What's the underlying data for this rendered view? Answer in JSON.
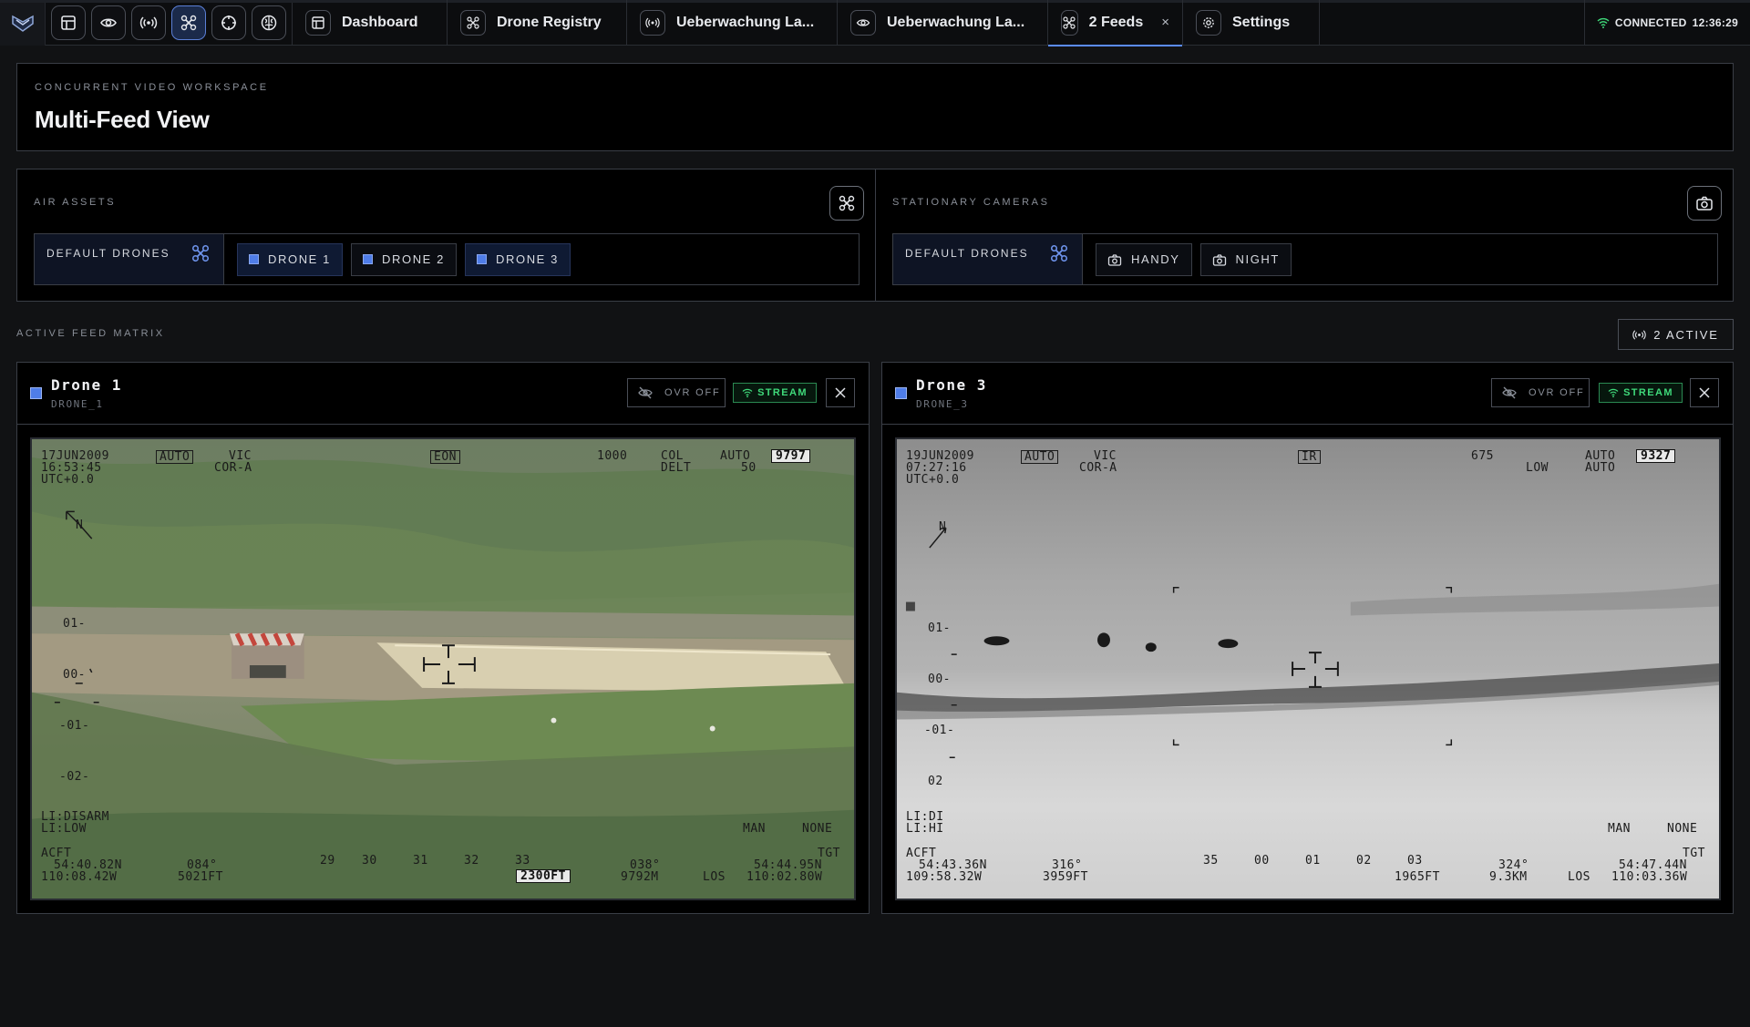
{
  "topbar": {
    "tabs": [
      {
        "label": "Dashboard",
        "icon": "dashboard-icon"
      },
      {
        "label": "Drone Registry",
        "icon": "drone-icon"
      },
      {
        "label": "Ueberwachung La...",
        "icon": "broadcast-icon"
      },
      {
        "label": "Ueberwachung La...",
        "icon": "eye-icon"
      },
      {
        "label": "2 Feeds",
        "icon": "drone-icon",
        "active": true,
        "close": "×"
      },
      {
        "label": "Settings",
        "icon": "gear-icon"
      }
    ],
    "status": "CONNECTED",
    "time": "12:36:29"
  },
  "header": {
    "kicker": "CONCURRENT VIDEO WORKSPACE",
    "title": "Multi-Feed View"
  },
  "assets": {
    "air": {
      "kicker": "AIR ASSETS",
      "default_label": "DEFAULT DRONES",
      "items": [
        "DRONE 1",
        "DRONE 2",
        "DRONE 3"
      ]
    },
    "cameras": {
      "kicker": "STATIONARY CAMERAS",
      "default_label": "DEFAULT DRONES",
      "items": [
        "HANDY",
        "NIGHT"
      ]
    }
  },
  "matrix": {
    "label": "ACTIVE FEED MATRIX",
    "active_count": "2 ACTIVE"
  },
  "feeds": [
    {
      "title": "Drone 1",
      "id": "DRONE_1",
      "overlay": "OVR OFF",
      "stream": "STREAM",
      "osd": {
        "date": "17JUN2009",
        "time": "16:53:45",
        "utc": "UTC+0.0",
        "mode": "AUTO",
        "vic": "VIC",
        "cor": "COR-A",
        "sensor": "EON",
        "r1": "1000",
        "col": "COL",
        "delt": "DELT",
        "auto2": "AUTO",
        "fifty": "50",
        "tgt_num": "9797",
        "north": "N",
        "pitch": [
          "01-",
          "00-",
          "-01-",
          "-02-"
        ],
        "li1": "LI:DISARM",
        "li2": "LI:LOW",
        "man": "MAN",
        "none": "NONE",
        "acft": "ACFT",
        "acft_lat": "54:40.82N",
        "acft_lon": "110:08.42W",
        "hdg": "084°",
        "alt": "5021FT",
        "scale": [
          "29",
          "30",
          "31",
          "32",
          "33"
        ],
        "box_alt": "2300FT",
        "brg": "038°",
        "rng": "9792M",
        "los": "LOS",
        "tgt": "TGT",
        "tgt_lat": "54:44.95N",
        "tgt_lon": "110:02.80W"
      }
    },
    {
      "title": "Drone 3",
      "id": "DRONE_3",
      "overlay": "OVR OFF",
      "stream": "STREAM",
      "osd": {
        "date": "19JUN2009",
        "time": "07:27:16",
        "utc": "UTC+0.0",
        "mode": "AUTO",
        "vic": "VIC",
        "cor": "COR-A",
        "sensor": "IR",
        "r1": "675",
        "low": "LOW",
        "auto2": "AUTO",
        "auto3": "AUTO",
        "tgt_num": "9327",
        "north": "N",
        "pitch": [
          "01-",
          "00-",
          "-01-",
          "02"
        ],
        "li1": "LI:DI",
        "li2": "LI:HI",
        "man": "MAN",
        "none": "NONE",
        "acft": "ACFT",
        "acft_lat": "54:43.36N",
        "acft_lon": "109:58.32W",
        "hdg": "316°",
        "alt": "3959FT",
        "scale": [
          "35",
          "00",
          "01",
          "02",
          "03"
        ],
        "box_alt": "1965FT",
        "brg": "324°",
        "rng": "9.3KM",
        "los": "LOS",
        "tgt": "TGT",
        "tgt_lat": "54:47.44N",
        "tgt_lon": "110:03.36W"
      }
    }
  ],
  "colors": {
    "accent": "#5b8cff",
    "stream": "#3fd97a",
    "chip": "#4f7de8"
  }
}
